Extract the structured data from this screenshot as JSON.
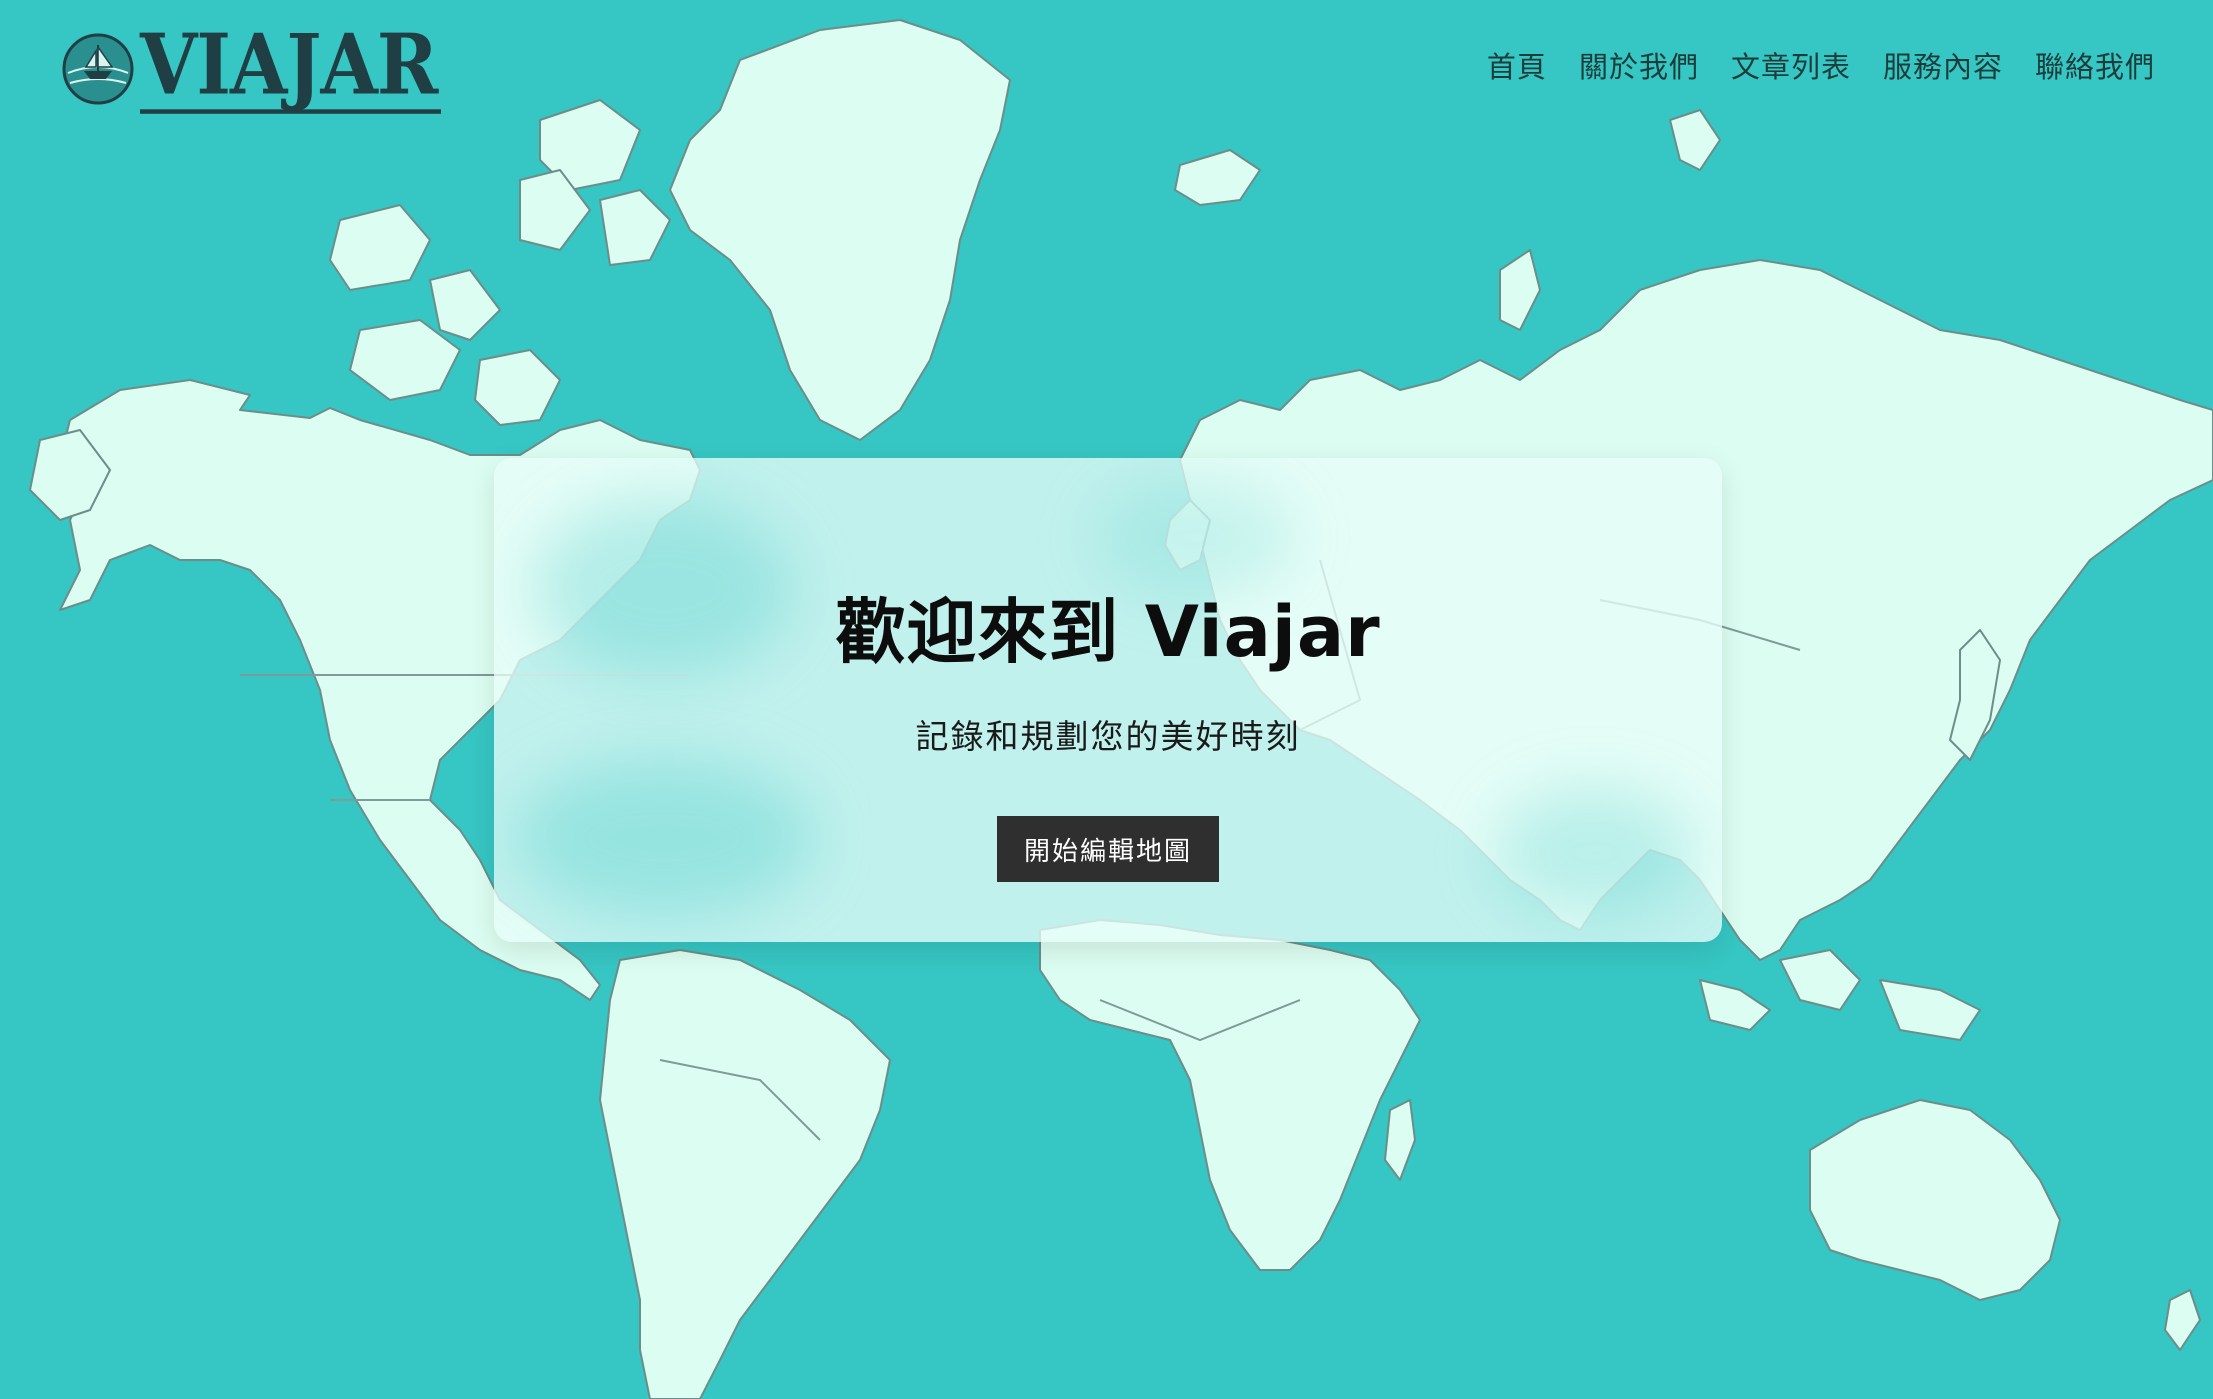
{
  "brand": {
    "logo_text": "VIAJAR",
    "emblem": "ship-globe-icon"
  },
  "nav": {
    "items": [
      {
        "label": "首頁"
      },
      {
        "label": "關於我們"
      },
      {
        "label": "文章列表"
      },
      {
        "label": "服務內容"
      },
      {
        "label": "聯絡我們"
      }
    ]
  },
  "hero": {
    "title": "歡迎來到 Viajar",
    "subtitle": "記錄和規劃您的美好時刻",
    "cta_label": "開始編輯地圖"
  },
  "colors": {
    "ocean": "#36c6c3",
    "land": "#dcfdf1",
    "button": "#2f2f2f",
    "text_dark": "#1d3d3b"
  }
}
